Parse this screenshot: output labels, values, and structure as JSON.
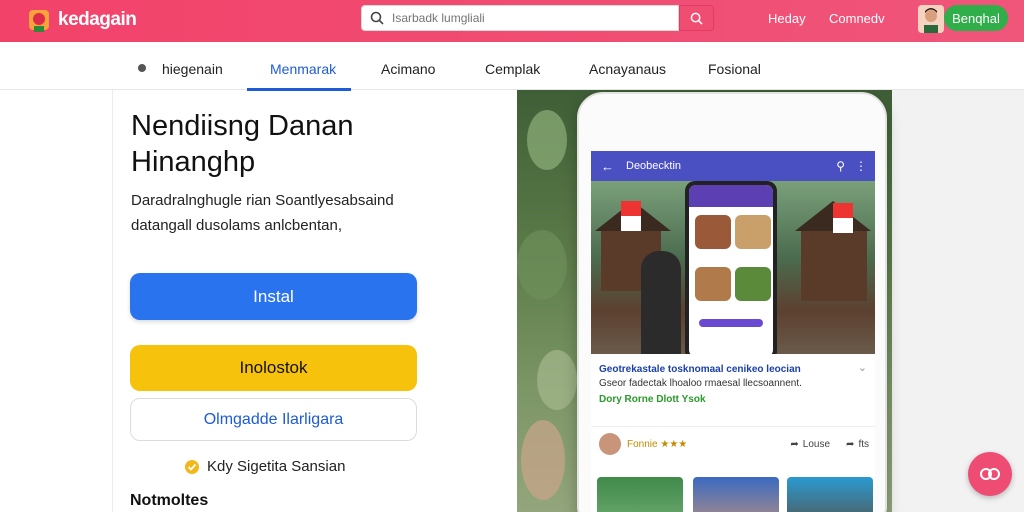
{
  "header": {
    "brand": "kedagain",
    "search_placeholder": "Isarbadk lumgliali",
    "nav": [
      "Heday",
      "Comnedv"
    ],
    "signup_label": "Benqhal"
  },
  "tabs": [
    {
      "label": "hiegenain"
    },
    {
      "label": "Menmarak"
    },
    {
      "label": "Acimano"
    },
    {
      "label": "Cemplak"
    },
    {
      "label": "Acnayanaus"
    },
    {
      "label": "Fosional"
    }
  ],
  "active_tab": "Menmarak",
  "main": {
    "title_line1": "Nendiisng Danan",
    "title_line2": "Hinanghp",
    "desc_line1": "Daradralnghugle rian Soantlyesabsaind",
    "desc_line2": "datangall dusolams anlcbentan,",
    "install_label": "Instal",
    "secondary_label": "Inolostok",
    "outline_label": "Olmgadde Ilarligara",
    "check_label": "Kdy Sigetita Sansian",
    "notes_heading": "Notmoltes"
  },
  "phone": {
    "app_title": "Deobecktin",
    "card_title": "Geotrekastale tosknomaal cenikeo leocian",
    "card_sub": "Gseor fadectak lhoaloo rmaesal llecsoannent.",
    "card_green": "Dory Rorne Dlott Ysok",
    "author": "Fonnie ★★★",
    "action1": "Louse",
    "action2": "fts"
  },
  "colors": {
    "header": "#f2426a",
    "primary": "#2a73ef",
    "secondary": "#f6c20c",
    "link": "#1d5bd8",
    "signup": "#2fae4a"
  }
}
